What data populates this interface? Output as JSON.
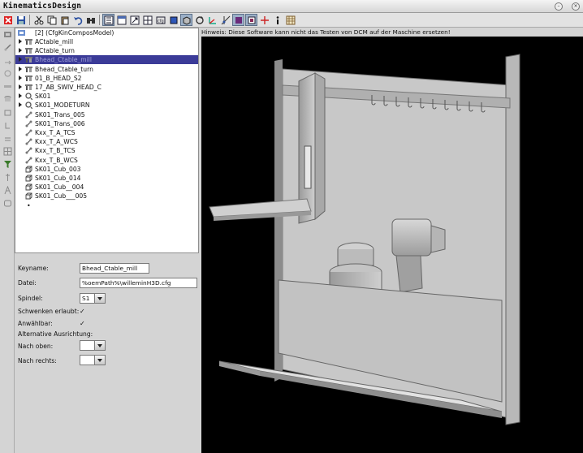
{
  "window": {
    "title": "KinematicsDesign"
  },
  "tree": {
    "root_label": "[2]  (CfgKinComposModel)",
    "items": [
      {
        "label": "ACtable_mill",
        "icon": "table-icon"
      },
      {
        "label": "ACtable_turn",
        "icon": "table-icon"
      },
      {
        "label": "Bhead_Ctable_mill",
        "icon": "table-icon"
      },
      {
        "label": "Bhead_Ctable_turn",
        "icon": "table-icon"
      },
      {
        "label": "01_B_HEAD_S2",
        "icon": "table-icon"
      },
      {
        "label": "17_AB_SWIV_HEAD_C",
        "icon": "table-icon"
      },
      {
        "label": "SK01",
        "icon": "axis-icon"
      },
      {
        "label": "SK01_MODETURN",
        "icon": "axis-icon"
      },
      {
        "label": "SK01_Trans_005",
        "icon": "transform-icon"
      },
      {
        "label": "SK01_Trans_006",
        "icon": "transform-icon"
      },
      {
        "label": "Kxx_T_A_TCS",
        "icon": "transform-icon"
      },
      {
        "label": "Kxx_T_A_WCS",
        "icon": "transform-icon"
      },
      {
        "label": "Kxx_T_B_TCS",
        "icon": "transform-icon"
      },
      {
        "label": "Kxx_T_B_WCS",
        "icon": "transform-icon"
      },
      {
        "label": "SK01_Cub_003",
        "icon": "cube-icon"
      },
      {
        "label": "SK01_Cub_014",
        "icon": "cube-icon"
      },
      {
        "label": "SK01_Cub__004",
        "icon": "cube-icon"
      },
      {
        "label": "SK01_Cub___005",
        "icon": "cube-icon"
      }
    ],
    "end_marker": "•",
    "selected_index": 2
  },
  "properties": {
    "keyname_label": "Keyname:",
    "keyname_value": "Bhead_Ctable_mill",
    "datei_label": "Datei:",
    "datei_value": "%oemPath%\\willeminH3D.cfg",
    "spindel_label": "Spindel:",
    "spindel_value": "S1",
    "schwenken_label": "Schwenken erlaubt:",
    "schwenken_checked": true,
    "anwaehlbar_label": "Anwählbar:",
    "anwaehlbar_checked": true,
    "alt_ausrichtung_label": "Alternative Ausrichtung:",
    "nach_oben_label": "Nach oben:",
    "nach_oben_value": "",
    "nach_rechts_label": "Nach rechts:",
    "nach_rechts_value": "",
    "check_glyph": "✓"
  },
  "viewport": {
    "hint": "Hinweis: Diese Software kann nicht das Testen von DCM auf der Maschine ersetzen!"
  },
  "colors": {
    "selection": "#3b3b98",
    "viewport_bg": "#000000",
    "machine_gray": "#bcbcbc"
  }
}
